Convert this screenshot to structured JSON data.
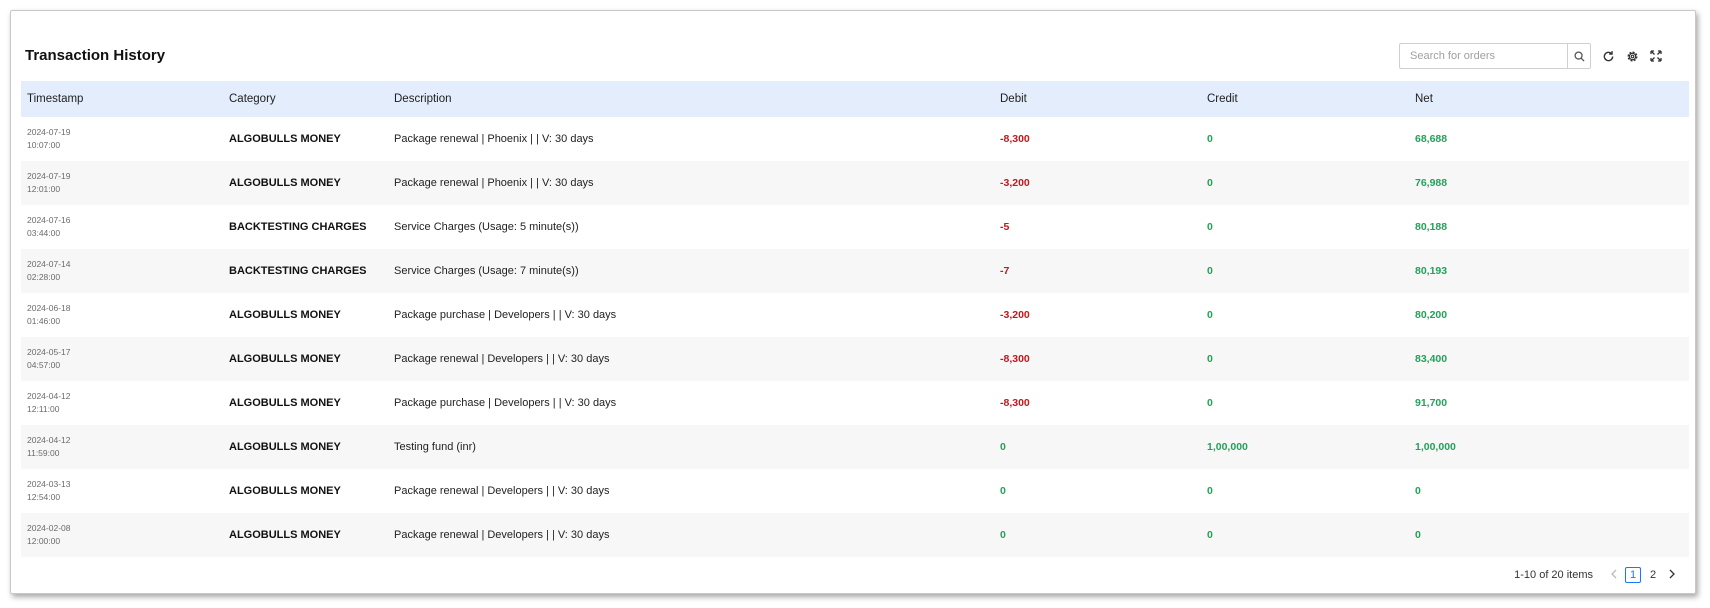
{
  "card": {
    "title": "Transaction History"
  },
  "search": {
    "placeholder": "Search for orders"
  },
  "table": {
    "columns": {
      "timestamp": "Timestamp",
      "category": "Category",
      "description": "Description",
      "debit": "Debit",
      "credit": "Credit",
      "net": "Net"
    },
    "rows": [
      {
        "date": "2024-07-19",
        "time": "10:07:00",
        "category": "ALGOBULLS MONEY",
        "description": "Package renewal | Phoenix | | V: 30 days",
        "debit": "-8,300",
        "credit": "0",
        "net": "68,688"
      },
      {
        "date": "2024-07-19",
        "time": "12:01:00",
        "category": "ALGOBULLS MONEY",
        "description": "Package renewal | Phoenix | | V: 30 days",
        "debit": "-3,200",
        "credit": "0",
        "net": "76,988"
      },
      {
        "date": "2024-07-16",
        "time": "03:44:00",
        "category": "BACKTESTING CHARGES",
        "description": "Service Charges (Usage: 5 minute(s))",
        "debit": "-5",
        "credit": "0",
        "net": "80,188"
      },
      {
        "date": "2024-07-14",
        "time": "02:28:00",
        "category": "BACKTESTING CHARGES",
        "description": "Service Charges (Usage: 7 minute(s))",
        "debit": "-7",
        "credit": "0",
        "net": "80,193"
      },
      {
        "date": "2024-06-18",
        "time": "01:46:00",
        "category": "ALGOBULLS MONEY",
        "description": "Package purchase | Developers | | V: 30 days",
        "debit": "-3,200",
        "credit": "0",
        "net": "80,200"
      },
      {
        "date": "2024-05-17",
        "time": "04:57:00",
        "category": "ALGOBULLS MONEY",
        "description": "Package renewal | Developers | | V: 30 days",
        "debit": "-8,300",
        "credit": "0",
        "net": "83,400"
      },
      {
        "date": "2024-04-12",
        "time": "12:11:00",
        "category": "ALGOBULLS MONEY",
        "description": "Package purchase | Developers | | V: 30 days",
        "debit": "-8,300",
        "credit": "0",
        "net": "91,700"
      },
      {
        "date": "2024-04-12",
        "time": "11:59:00",
        "category": "ALGOBULLS MONEY",
        "description": "Testing fund (inr)",
        "debit": "0",
        "credit": "1,00,000",
        "net": "1,00,000"
      },
      {
        "date": "2024-03-13",
        "time": "12:54:00",
        "category": "ALGOBULLS MONEY",
        "description": "Package renewal | Developers | | V: 30 days",
        "debit": "0",
        "credit": "0",
        "net": "0"
      },
      {
        "date": "2024-02-08",
        "time": "12:00:00",
        "category": "ALGOBULLS MONEY",
        "description": "Package renewal | Developers | | V: 30 days",
        "debit": "0",
        "credit": "0",
        "net": "0"
      }
    ]
  },
  "pagination": {
    "total_text": "1-10 of 20 items",
    "pages": [
      "1",
      "2"
    ],
    "current": "1"
  },
  "colors": {
    "negative": "#c4161c",
    "positive": "#23a15a",
    "header_bg": "#e4edfc",
    "accent": "#1677ff"
  },
  "icons": {
    "search": "search-icon",
    "refresh": "refresh-icon",
    "settings": "gear-icon",
    "fullscreen": "fullscreen-icon",
    "prev": "chevron-left-icon",
    "next": "chevron-right-icon"
  }
}
